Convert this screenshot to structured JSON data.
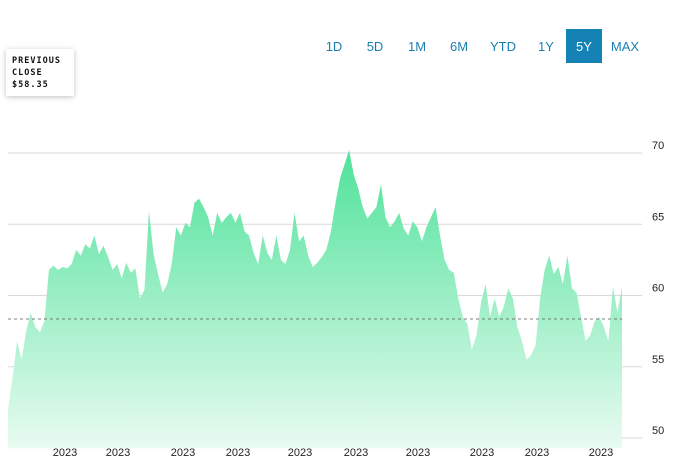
{
  "range_selector": {
    "buttons": [
      {
        "label": "1D",
        "active": false
      },
      {
        "label": "5D",
        "active": false
      },
      {
        "label": "1M",
        "active": false
      },
      {
        "label": "6M",
        "active": false
      },
      {
        "label": "YTD",
        "active": false
      },
      {
        "label": "1Y",
        "active": false
      },
      {
        "label": "5Y",
        "active": true
      },
      {
        "label": "MAX",
        "active": false
      }
    ]
  },
  "previous_close": {
    "label_line1": "PREVIOUS",
    "label_line2": "CLOSE",
    "value": "$58.35",
    "numeric": 58.35
  },
  "colors": {
    "area_top": "#4fe29a",
    "area_bottom": "#e8fbf1",
    "gridline": "#d9d9d9",
    "accent_button": "#1582b6",
    "button_text": "#1a7fb0"
  },
  "chart_data": {
    "type": "area",
    "title": "",
    "xlabel": "",
    "ylabel": "",
    "ylim": [
      49,
      71
    ],
    "y_ticks": [
      50,
      55,
      60,
      65,
      70
    ],
    "y_tick_labels": [
      "50",
      "55",
      "60",
      "65",
      "70"
    ],
    "x_tick_labels": [
      "2023",
      "2023",
      "2023",
      "2023",
      "2023",
      "2023",
      "2023",
      "2023",
      "2023",
      "2023",
      "2023"
    ],
    "grid": true,
    "reference_line": 58.35,
    "series": [
      {
        "values": [
          52,
          54.2,
          56.8,
          55.5,
          57.5,
          58.8,
          57.8,
          57.4,
          58.2,
          61.8,
          62.1,
          61.8,
          62.0,
          61.9,
          62.2,
          63.2,
          62.8,
          63.6,
          63.3,
          64.2,
          62.9,
          63.5,
          62.7,
          61.8,
          62.2,
          61.2,
          62.3,
          61.6,
          61.9,
          59.8,
          60.4,
          65.9,
          62.9,
          61.5,
          60.2,
          60.8,
          62.2,
          64.8,
          64.2,
          65.1,
          64.8,
          66.5,
          66.8,
          66.2,
          65.5,
          64.2,
          65.8,
          65.1,
          65.5,
          65.8,
          65.1,
          65.8,
          64.5,
          64.2,
          63.0,
          62.2,
          64.2,
          63.0,
          62.5,
          64.2,
          62.5,
          62.2,
          63.2,
          65.8,
          63.8,
          64.2,
          62.8,
          62.0,
          62.3,
          62.7,
          63.2,
          64.5,
          66.5,
          68.2,
          69.2,
          70.2,
          68.5,
          67.5,
          66.2,
          65.4,
          65.8,
          66.2,
          67.8,
          65.5,
          64.8,
          65.2,
          65.8,
          64.7,
          64.2,
          65.2,
          64.8,
          63.8,
          64.8,
          65.5,
          66.2,
          64.2,
          62.5,
          61.8,
          61.6,
          59.8,
          58.5,
          58.0,
          56.2,
          57.2,
          59.5,
          60.8,
          58.5,
          59.8,
          58.5,
          59.2,
          60.5,
          59.8,
          57.8,
          56.8,
          55.5,
          55.8,
          56.5,
          59.8,
          61.8,
          62.8,
          61.5,
          62.0,
          60.8,
          62.8,
          60.5,
          60.2,
          58.5,
          56.8,
          57.2,
          58.2,
          58.5,
          57.8,
          56.8,
          60.6,
          58.8,
          60.6
        ]
      }
    ]
  }
}
